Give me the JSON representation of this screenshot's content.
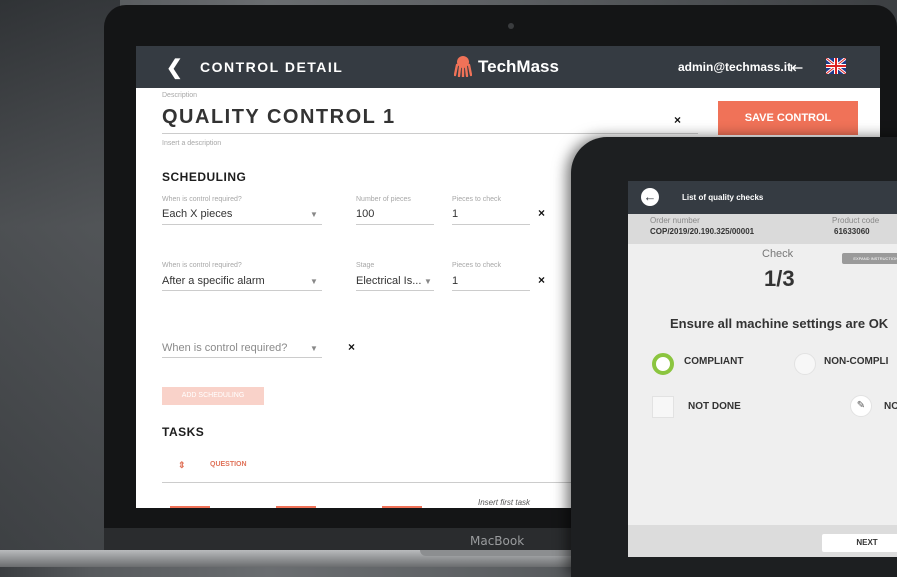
{
  "header": {
    "back_icon": "chevron-left-icon",
    "title": "CONTROL DETAIL",
    "brand": "TechMass",
    "user": "admin@techmass.it",
    "logout_icon": "logout-icon",
    "language_icon": "uk-flag-icon"
  },
  "form": {
    "description_label": "Description",
    "title": "QUALITY CONTROL 1",
    "description_placeholder": "Insert a description",
    "save_label": "SAVE CONTROL",
    "remove_icon": "×"
  },
  "scheduling": {
    "heading": "SCHEDULING",
    "rows": [
      {
        "when_label": "When is control required?",
        "when_value": "Each X pieces",
        "second_label": "Number of pieces",
        "second_value": "100",
        "pieces_label": "Pieces to check",
        "pieces_value": "1",
        "remove": "×"
      },
      {
        "when_label": "When is control required?",
        "when_value": "After a specific alarm",
        "second_label": "Stage",
        "second_value": "Electrical Is...",
        "pieces_label": "Pieces to check",
        "pieces_value": "1",
        "remove": "×"
      }
    ],
    "empty_placeholder": "When is control required?",
    "empty_remove": "×",
    "add_label": "ADD SCHEDULING"
  },
  "tasks": {
    "heading": "TASKS",
    "sort_icon": "⇕",
    "column_question": "QUESTION",
    "empty_text": "Insert first task"
  },
  "laptop": {
    "brand": "MacBook"
  },
  "tablet": {
    "title": "List of quality checks",
    "order_label": "Order number",
    "order_value": "COP/2019/20.190.325/00001",
    "product_label": "Product code",
    "product_value": "61633060",
    "check_label": "Check",
    "check_count": "1/3",
    "expand_label": "EXPAND INSTRUCTIONS",
    "question": "Ensure all machine settings are OK",
    "option_compliant": "COMPLIANT",
    "option_noncompliant": "NON-COMPLI",
    "option_notdone": "NOT DONE",
    "option_note": "NO",
    "next_label": "NEXT",
    "colors": {
      "header": "#353b42",
      "accent": "#f07258",
      "check": "#8bc53f"
    }
  }
}
